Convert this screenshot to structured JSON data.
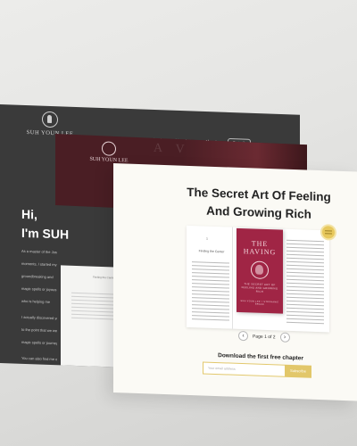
{
  "back_site": {
    "brand": "SUH YOUN LEE",
    "nav": [
      "Books",
      "Newsletter",
      "About"
    ],
    "nav_active": "About",
    "search_label": "Search",
    "hero_title": "Hi,",
    "hero_subtitle": "I'm SUH",
    "body_lines": [
      "As a master of the Jose",
      "moments, I started my",
      "groundbreaking and",
      "magic spells or joyous",
      "who is helping me"
    ],
    "body_more": [
      "I actually discovered you",
      "to the point that we were",
      "magic spells or journey"
    ],
    "body_tail": "You can also find me on",
    "accent_color": "#3a3a3a"
  },
  "middle_site": {
    "brand": "SUH YOUN LEE",
    "nav": [
      "Books",
      "Newsletter",
      "About"
    ],
    "nav_active": "Books",
    "search_label": "Search",
    "accent_color": "#4a1e24"
  },
  "front_site": {
    "title": "The Secret Art Of Feeling And Growing Rich",
    "left_page": {
      "chapter_number": "1",
      "chapter_title": "Finding the Center"
    },
    "book": {
      "cover_title": "THE HAVING",
      "cover_subtitle": "THE SECRET ART OF FEELING AND GROWING RICH",
      "cover_author": "SUH YOUN LEE • STEPHANIE BRACK",
      "cover_color": "#a02545"
    },
    "pager": {
      "prev_icon": "chevron-left-icon",
      "next_icon": "chevron-right-icon",
      "label": "Page 1 of 2"
    },
    "cta": {
      "title": "Download the first free chapter",
      "email_placeholder": "Your email address",
      "button_label": "Subscribe"
    },
    "colors": {
      "background": "#fbfaf5",
      "gold": "#e2c76a"
    }
  }
}
